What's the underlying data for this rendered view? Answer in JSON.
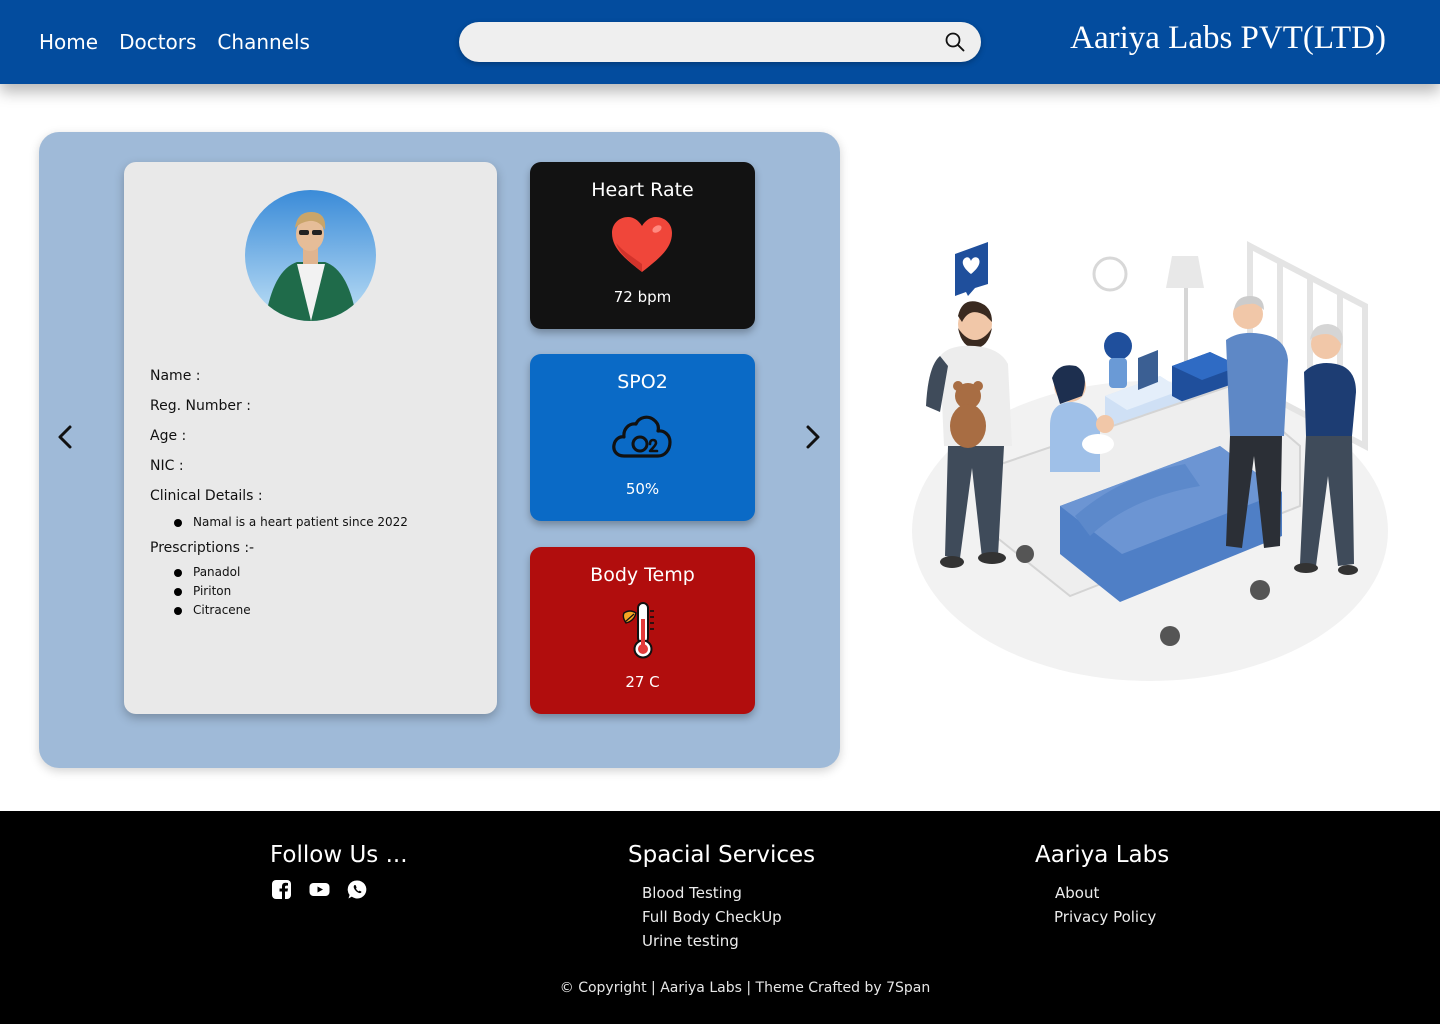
{
  "header": {
    "nav": [
      "Home",
      "Doctors",
      "Channels"
    ],
    "search": {
      "value": "",
      "placeholder": ""
    },
    "brand": "Aariya Labs PVT(LTD)"
  },
  "patient": {
    "labels": {
      "name": "Name :",
      "reg": "Reg. Number :",
      "age": "Age :",
      "nic": "NIC :",
      "clinical": "Clinical Details :",
      "prescriptions": "Prescriptions :-"
    },
    "clinical_details": [
      "Namal is a heart patient since 2022"
    ],
    "prescriptions": [
      "Panadol",
      "Piriton",
      "Citracene"
    ]
  },
  "stats": {
    "heart": {
      "title": "Heart Rate",
      "value": "72 bpm",
      "color": "#121212",
      "icon": "heart-icon"
    },
    "spo2": {
      "title": "SPO2",
      "value": "50%",
      "color": "#0a6ac6",
      "icon": "o2-cloud-icon"
    },
    "temp": {
      "title": "Body Temp",
      "value": "27 C",
      "color": "#b10d0d",
      "icon": "thermometer-icon"
    }
  },
  "footer": {
    "follow_title": "Follow Us ...",
    "social": [
      "facebook-icon",
      "youtube-icon",
      "whatsapp-icon"
    ],
    "services_title": "Spacial Services",
    "services": [
      "Blood Testing",
      "Full Body CheckUp",
      "Urine testing"
    ],
    "labs_title": "Aariya Labs",
    "labs_links": [
      "About",
      "Privacy Policy"
    ],
    "copyright": "© Copyright | Aariya Labs | Theme Crafted by 7Span"
  },
  "colors": {
    "header": "#034c9e",
    "panel": "#9fbad8",
    "card": "#e9e9e9",
    "footer": "#000000"
  }
}
